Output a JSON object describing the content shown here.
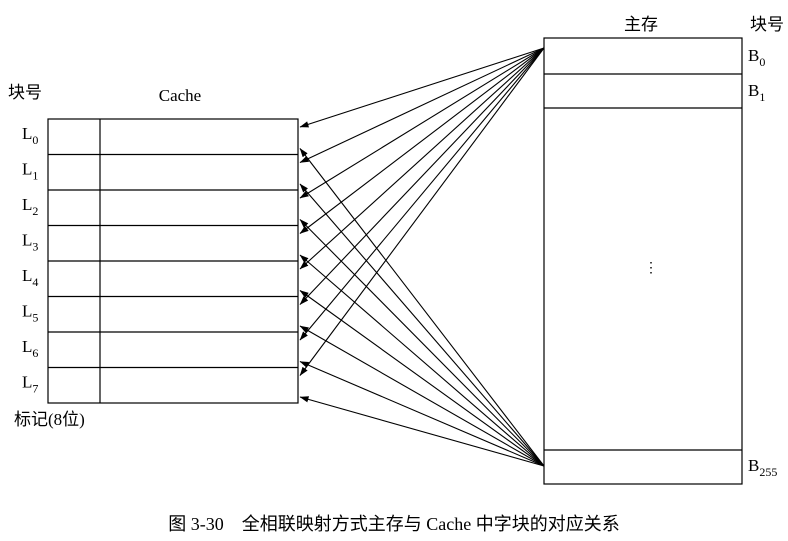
{
  "cache": {
    "col_header": "块号",
    "title": "Cache",
    "tag_note": "标记(8位)",
    "lines": [
      {
        "base": "L",
        "sub": "0"
      },
      {
        "base": "L",
        "sub": "1"
      },
      {
        "base": "L",
        "sub": "2"
      },
      {
        "base": "L",
        "sub": "3"
      },
      {
        "base": "L",
        "sub": "4"
      },
      {
        "base": "L",
        "sub": "5"
      },
      {
        "base": "L",
        "sub": "6"
      },
      {
        "base": "L",
        "sub": "7"
      }
    ]
  },
  "main_memory": {
    "title": "主存",
    "col_header": "块号",
    "ellipsis": "⋮",
    "blocks": [
      {
        "base": "B",
        "sub": "0"
      },
      {
        "base": "B",
        "sub": "1"
      },
      {
        "base": "B",
        "sub": "255"
      }
    ]
  },
  "caption": "图 3-30　全相联映射方式主存与 Cache 中字块的对应关系"
}
